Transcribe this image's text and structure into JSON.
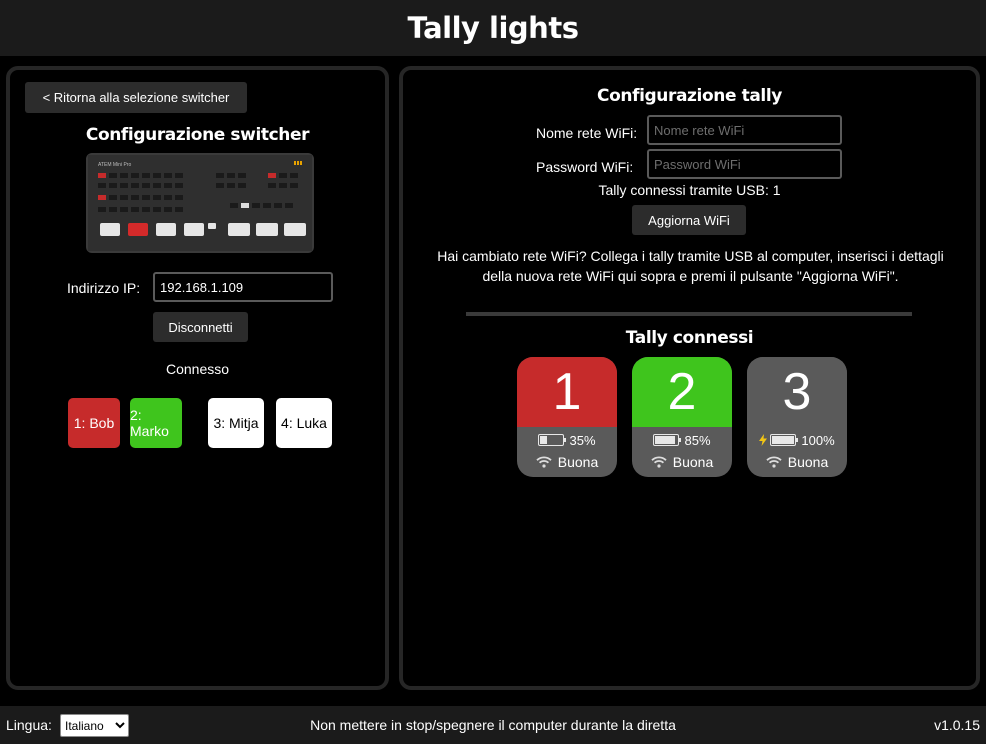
{
  "header": {
    "title": "Tally lights"
  },
  "switcher_panel": {
    "back_button": "< Ritorna alla selezione switcher",
    "title": "Configurazione switcher",
    "device_image_label": "ATEM Mini Pro",
    "ip_label": "Indirizzo IP:",
    "ip_value": "192.168.1.109",
    "disconnect_button": "Disconnetti",
    "status": "Connesso",
    "cameras": [
      {
        "label": "1: Bob",
        "state": "program",
        "color": "#c62b2b"
      },
      {
        "label": "2: Marko",
        "state": "preview",
        "color": "#3fc51d"
      },
      {
        "label": "3: Mitja",
        "state": "idle",
        "color": "#ffffff"
      },
      {
        "label": "4: Luka",
        "state": "idle",
        "color": "#ffffff"
      }
    ]
  },
  "tally_panel": {
    "title": "Configurazione tally",
    "wifi_name_label": "Nome rete WiFi:",
    "wifi_name_placeholder": "Nome rete WiFi",
    "wifi_password_label": "Password WiFi:",
    "wifi_password_placeholder": "Password WiFi",
    "usb_status": "Tally connessi tramite USB: 1",
    "update_button": "Aggiorna WiFi",
    "info_line1": "Hai cambiato rete WiFi? Collega i tally tramite USB al computer, inserisci i dettagli",
    "info_line2": "della nuova rete WiFi qui sopra e premi il pulsante \"Aggiorna WiFi\".",
    "connected_title": "Tally connessi",
    "tallies": [
      {
        "number": "1",
        "color": "#c62b2b",
        "battery": "35%",
        "battery_level": 0.35,
        "charging": false,
        "signal": "Buona",
        "icon": "battery-icon"
      },
      {
        "number": "2",
        "color": "#3fc51d",
        "battery": "85%",
        "battery_level": 0.85,
        "charging": false,
        "signal": "Buona",
        "icon": "battery-icon"
      },
      {
        "number": "3",
        "color": "#5a5a5a",
        "battery": "100%",
        "battery_level": 1.0,
        "charging": true,
        "signal": "Buona",
        "icon": "battery-charging-icon"
      }
    ]
  },
  "footer": {
    "language_label": "Lingua:",
    "language_value": "Italiano",
    "notice": "Non mettere in stop/spegnere il computer durante la diretta",
    "version": "v1.0.15"
  }
}
